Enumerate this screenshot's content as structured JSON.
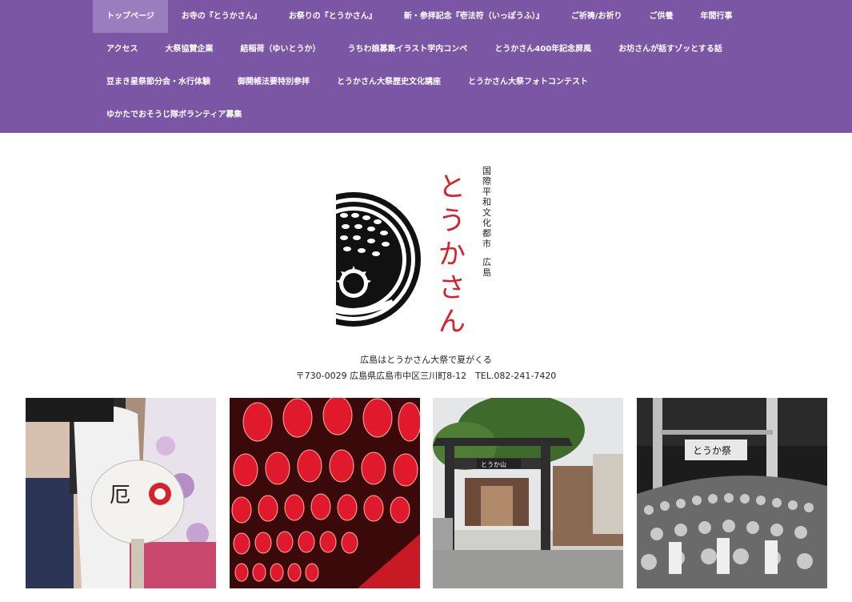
{
  "nav": {
    "rows": [
      [
        "トップページ",
        "お寺の『とうかさん』",
        "お祭りの『とうかさん』",
        "新・参拝記念『壱法符（いっぽうふ）』",
        "ご祈祷/お祈り",
        "ご供養",
        "年間行事"
      ],
      [
        "アクセス",
        "大祭協賛企業",
        "結稲荷（ゆいとうか）",
        "うちわ娘募集イラスト学内コンペ",
        "とうかさん400年記念屏風",
        "お坊さんが話すゾッとする話"
      ],
      [
        "豆まき星祭節分会・水行体験",
        "御開帳法要特別参拝",
        "とうかさん大祭歴史文化講座",
        "とうかさん大祭フォトコンテスト"
      ],
      [
        "ゆかたでおそうじ隊ボランティア募集"
      ]
    ]
  },
  "logo": {
    "brand_chars": [
      "と",
      "う",
      "か",
      "さ",
      "ん"
    ],
    "city_text": "国際平和文化都市",
    "city_name": "広島"
  },
  "info": {
    "tagline": "広島はとうかさん大祭で夏がくる",
    "address": "〒730-0029 広島県広島市中区三川町8-12　TEL.082-241-7420"
  },
  "gallery": {
    "sign_text": "とうか山",
    "banner_text": "とうか祭"
  },
  "colors": {
    "nav_bg": "#7b56a4",
    "nav_active": "#9a7dbf",
    "brand_red": "#d9202b"
  }
}
